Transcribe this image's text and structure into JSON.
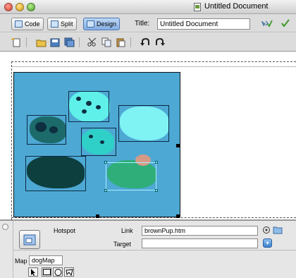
{
  "window": {
    "title": "Untitled Document"
  },
  "toolbar": {
    "view_buttons": [
      {
        "label": "Code"
      },
      {
        "label": "Split"
      },
      {
        "label": "Design",
        "active": true
      }
    ],
    "title_label": "Title:",
    "title_value": "Untitled Document",
    "validate_icon": "check-validate-icon",
    "browser_icon": "preview-browser-icon"
  },
  "insert_toolbar": {
    "icons": [
      "new-document-icon",
      "open-folder-icon",
      "save-icon",
      "save-all-icon",
      "cut-icon",
      "copy-icon",
      "paste-icon",
      "undo-icon",
      "redo-icon"
    ]
  },
  "canvas": {
    "image_background": "#4ea8d4",
    "hotspot_count": 5,
    "selected_hotspot": "brownPup"
  },
  "properties": {
    "element_label": "Hotspot",
    "link_label": "Link",
    "link_value": "brownPup.htm",
    "target_label": "Target",
    "target_value": "",
    "map_label": "Map",
    "map_value": "dogMap",
    "tools": [
      "pointer-hotspot-tool",
      "rectangle-hotspot-tool",
      "circle-hotspot-tool",
      "polygon-hotspot-tool"
    ]
  },
  "colors": {
    "accent": "#4a75b0",
    "hotspot_outline": "#0a2a40",
    "selected_hotspot": "#7ff4ff"
  }
}
